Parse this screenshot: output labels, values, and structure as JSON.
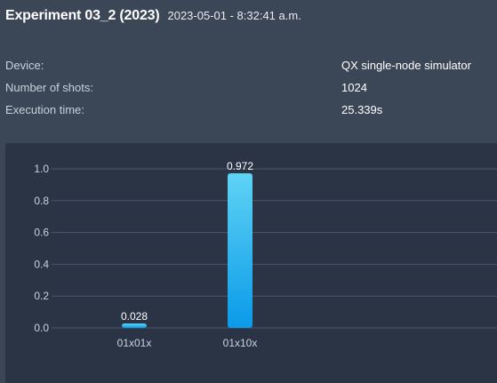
{
  "experiment": {
    "title": "Experiment 03_2 (2023)",
    "timestamp": "2023-05-01 - 8:32:41 a.m."
  },
  "details": [
    {
      "label": "Device:",
      "value": "QX single-node simulator"
    },
    {
      "label": "Number of shots:",
      "value": "1024"
    },
    {
      "label": "Execution time:",
      "value": "25.339s"
    }
  ],
  "colors": {
    "background": "#3b4656",
    "chart_background": "#2a3445",
    "bar_top": "#5fd3f5",
    "bar_bottom": "#0a9ae8",
    "grid": "#4a5668"
  },
  "chart_data": {
    "type": "bar",
    "categories": [
      "01x01x",
      "01x10x"
    ],
    "values": [
      0.028,
      0.972
    ],
    "data_labels": [
      "0.028",
      "0.972"
    ],
    "y_ticks": [
      "0.0",
      "0.2",
      "0.4",
      "0.6",
      "0.8",
      "1.0"
    ],
    "ylim": [
      0,
      1.0
    ],
    "grid": true,
    "title": "",
    "xlabel": "",
    "ylabel": ""
  }
}
